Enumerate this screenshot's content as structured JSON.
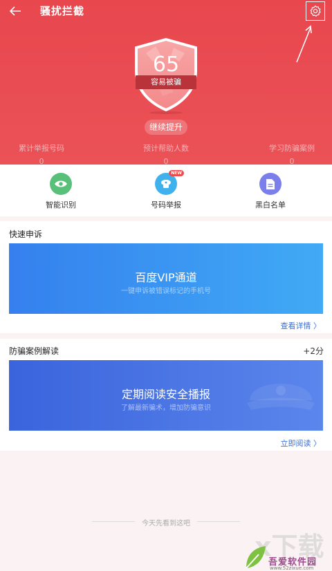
{
  "header": {
    "title": "骚扰拦截",
    "back_icon": "back-arrow-icon",
    "settings_icon": "gear-icon"
  },
  "score": {
    "value": "65",
    "ribbon_text": "容易被骗",
    "boost_label": "继续提升"
  },
  "stats": [
    {
      "label": "累计举报号码",
      "value": "0"
    },
    {
      "label": "预计帮助人数",
      "value": "0"
    },
    {
      "label": "学习防骗案例",
      "value": "0"
    }
  ],
  "shortcuts": [
    {
      "label": "智能识别",
      "icon": "eye-icon",
      "color": "#59c07a"
    },
    {
      "label": "号码举报",
      "icon": "report-icon",
      "color": "#3fb2ee",
      "badge": "NEW"
    },
    {
      "label": "黑白名单",
      "icon": "document-icon",
      "color": "#7b7fe9"
    }
  ],
  "quick_appeal": {
    "heading": "快速申诉",
    "banner_title": "百度VIP通道",
    "banner_subtitle": "一键申诉被错误标记的手机号",
    "link": "查看详情 〉"
  },
  "anti_fraud": {
    "heading": "防骗案例解读",
    "points": "+2分",
    "banner_title": "定期阅读安全播报",
    "banner_subtitle": "了解最新骗术，增加防骗意识",
    "link": "立即阅读 〉"
  },
  "footer": {
    "end_text": "今天先看到这吧"
  },
  "watermark": {
    "brand": "吾爱软件园",
    "site": "www.52zixue.com",
    "logo_text": "x下载"
  },
  "colors": {
    "hero": "#e8474e",
    "link": "#3b6fd1",
    "banner_blue_start": "#3580ee",
    "banner_blue_end": "#40aaf5",
    "banner_indigo_start": "#3a64dc",
    "banner_indigo_end": "#5b86ec"
  }
}
